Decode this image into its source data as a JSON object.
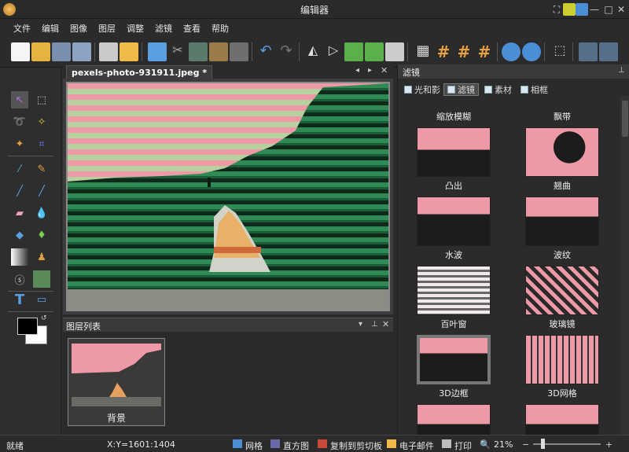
{
  "window": {
    "title": "编辑器"
  },
  "menu": [
    "文件",
    "编辑",
    "图像",
    "图层",
    "调整",
    "滤镜",
    "查看",
    "帮助"
  ],
  "document": {
    "tab_label": "pexels-photo-931911.jpeg *"
  },
  "layers_panel": {
    "title": "图层列表",
    "layer_name": "背景"
  },
  "filter_panel": {
    "title": "滤镜",
    "tabs": [
      "光和影",
      "滤镜",
      "素材",
      "相框"
    ],
    "items": [
      "缩放模糊",
      "飘带",
      "凸出",
      "翘曲",
      "水波",
      "波纹",
      "百叶窗",
      "玻璃镜",
      "3D边框",
      "3D网格"
    ]
  },
  "status": {
    "ready": "就绪",
    "coords": "X:Y=1601:1404",
    "grid": "网格",
    "histogram": "直方图",
    "copy": "复制到剪切板",
    "email": "电子邮件",
    "print": "打印",
    "zoom": "21%"
  },
  "colors": {
    "accent": "#4a8fd6",
    "pink": "#e8a0a6",
    "green": "#1d6b3f"
  }
}
